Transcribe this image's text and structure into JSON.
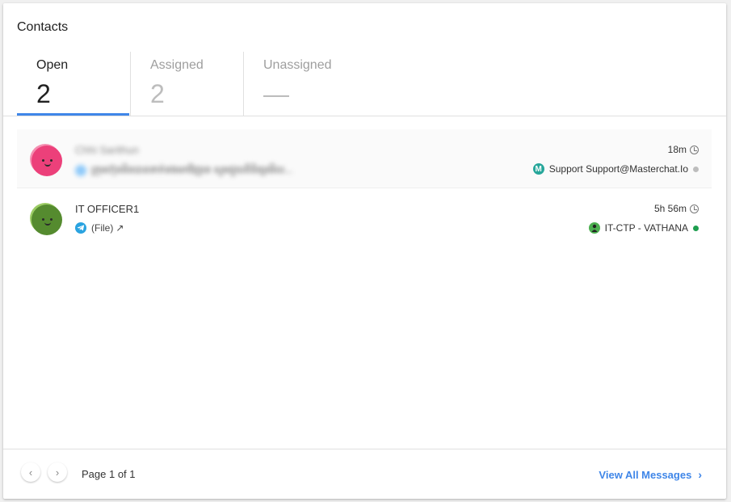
{
  "header": {
    "title": "Contacts"
  },
  "tabs": [
    {
      "label": "Open",
      "count": "2"
    },
    {
      "label": "Assigned",
      "count": "2"
    },
    {
      "label": "Unassigned",
      "count": "—"
    }
  ],
  "contacts": [
    {
      "name": "Chhi Sarithun",
      "preview": "ក្រុមហ៊ុនមិនបានទាក់ទងមកវិញទេ សូមជួយពិនិត្យមើល...",
      "time": "18m",
      "agent": "Support Support@Masterchat.Io",
      "agent_logo": "M",
      "status_color": "#bdbdbd",
      "avatar_color": "#ec407a",
      "avatar_back": "#f48fb1"
    },
    {
      "name": "IT OFFICER1",
      "preview": "(File)",
      "preview_icon": "↗",
      "time": "5h 56m",
      "agent": "IT-CTP - VATHANA",
      "status_color": "#1e9e4f",
      "avatar_color": "#558b2f",
      "avatar_back": "#9ccc65"
    }
  ],
  "footer": {
    "prev_icon": "‹",
    "next_icon": "›",
    "page_info": "Page 1 of 1",
    "view_all": "View All Messages",
    "view_all_icon": "›"
  },
  "colors": {
    "accent": "#3f86e8"
  }
}
